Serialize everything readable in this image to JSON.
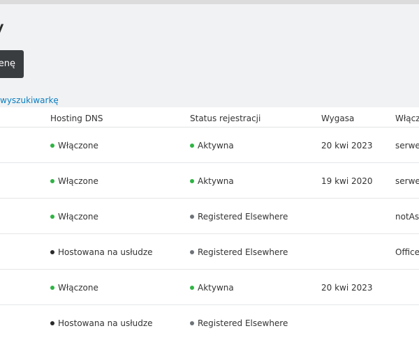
{
  "page": {
    "title": "y",
    "primary_button": "enę",
    "search_link": "wyszukiwarkę"
  },
  "table": {
    "headers": {
      "dns": "Hosting DNS",
      "status": "Status rejestracji",
      "expires": "Wygasa",
      "last": "Włączo"
    },
    "rows": [
      {
        "dns": "Włączone",
        "dns_state": "green",
        "status": "Aktywna",
        "status_state": "green",
        "expires": "20 kwi 2023",
        "last": "serwe"
      },
      {
        "dns": "Włączone",
        "dns_state": "green",
        "status": "Aktywna",
        "status_state": "green",
        "expires": "19 kwi 2020",
        "last": "serwe"
      },
      {
        "dns": "Włączone",
        "dns_state": "green",
        "status": "Registered Elsewhere",
        "status_state": "gray",
        "expires": "",
        "last": "notAs"
      },
      {
        "dns": "Hostowana na usłudze",
        "dns_state": "dark",
        "status": "Registered Elsewhere",
        "status_state": "gray",
        "expires": "",
        "last": "Office"
      },
      {
        "dns": "Włączone",
        "dns_state": "green",
        "status": "Aktywna",
        "status_state": "green",
        "expires": "20 kwi 2023",
        "last": ""
      },
      {
        "dns": "Hostowana na usłudze",
        "dns_state": "dark",
        "status": "Registered Elsewhere",
        "status_state": "gray",
        "expires": "",
        "last": ""
      }
    ]
  },
  "colors": {
    "active": "#2fb344",
    "hosted": "#2a2a2a",
    "elsewhere": "#6d7378",
    "link": "#0a7ec2"
  }
}
